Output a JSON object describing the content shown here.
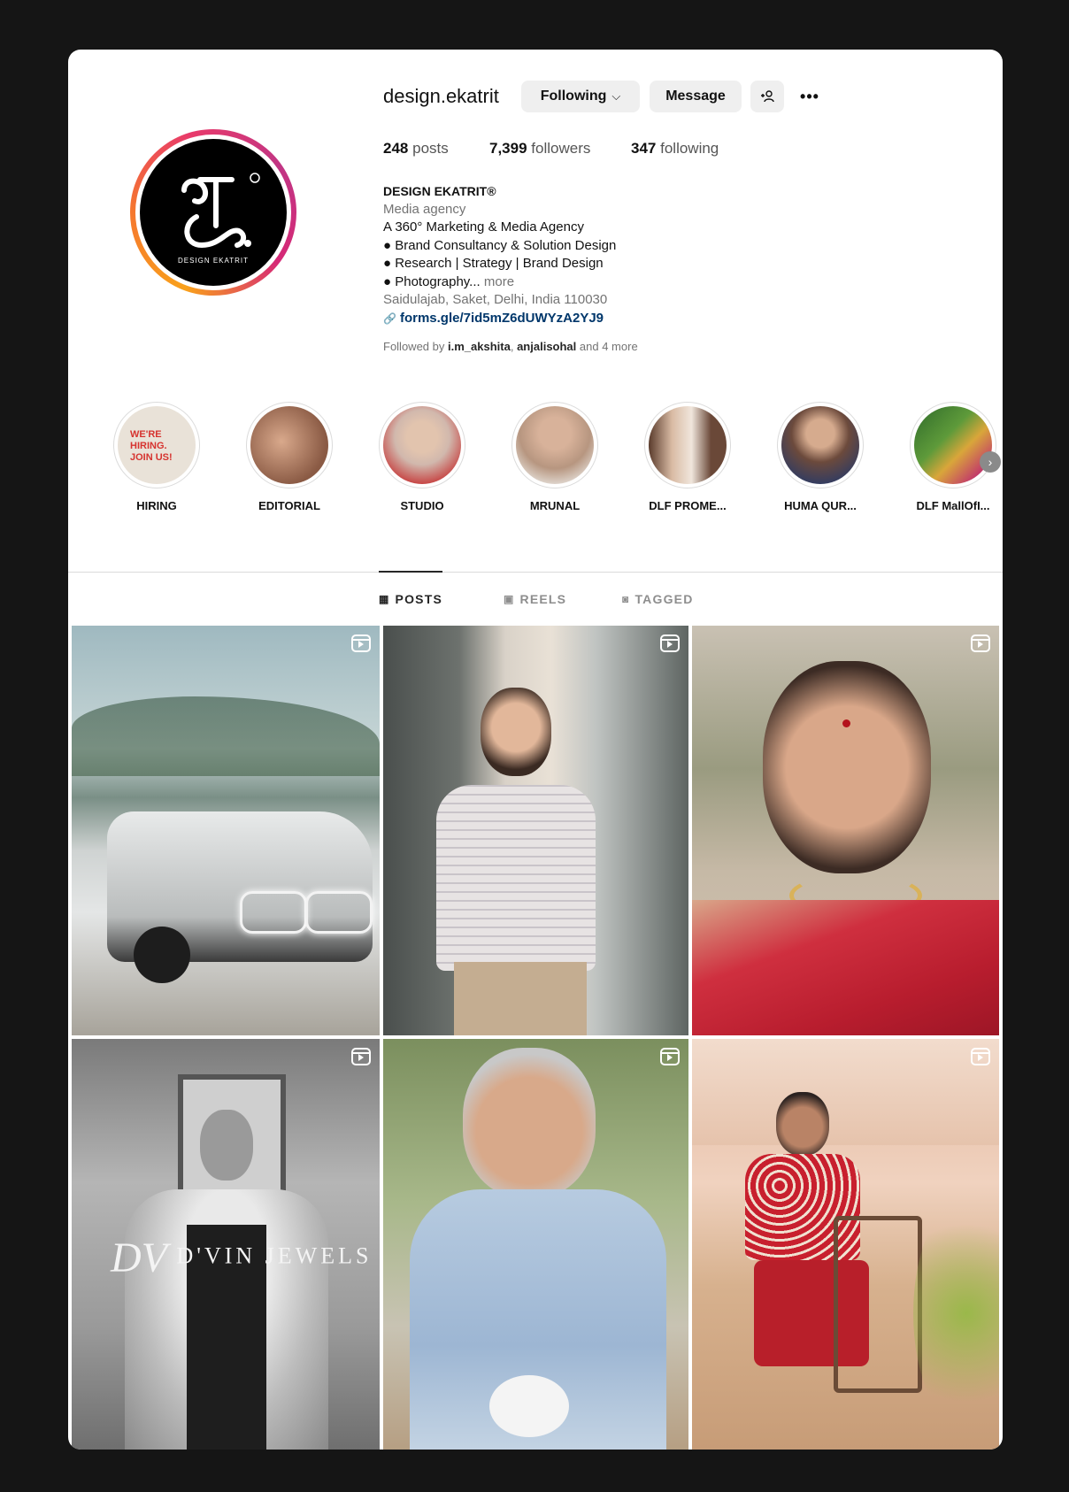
{
  "profile": {
    "username": "design.ekatrit",
    "following_label": "Following",
    "message_label": "Message",
    "add_user_icon": "add-user-icon",
    "more_icon": "more-icon",
    "avatar_caption": "DESIGN EKATRIT"
  },
  "stats": {
    "posts_count": "248",
    "posts_label": "posts",
    "followers_count": "7,399",
    "followers_label": "followers",
    "following_count": "347",
    "following_label": "following"
  },
  "bio": {
    "name": "DESIGN EKATRIT®",
    "category": "Media agency",
    "line1": "A 360° Marketing & Media Agency",
    "line2": "● Brand Consultancy & Solution Design",
    "line3": "● Research | Strategy | Brand Design",
    "line4": "● Photography...",
    "more": "more",
    "location": "Saidulajab, Saket, Delhi, India 110030",
    "link": "forms.gle/7id5mZ6dUWYzA2YJ9"
  },
  "followed_by": {
    "prefix": "Followed by",
    "user1": "i.m_akshita",
    "sep": ",",
    "user2": "anjalisohal",
    "suffix": "and 4 more"
  },
  "highlights": [
    {
      "label": "HIRING",
      "color": "#e9e2d8"
    },
    {
      "label": "EDITORIAL",
      "color": "#b58b72"
    },
    {
      "label": "STUDIO",
      "color": "#c9b7ad"
    },
    {
      "label": "MRUNAL",
      "color": "#a98a70"
    },
    {
      "label": "DLF PROME...",
      "color": "#8c6d5c"
    },
    {
      "label": "HUMA QUR...",
      "color": "#6f5548"
    },
    {
      "label": "DLF MallOfI...",
      "color": "#3f7a3a"
    }
  ],
  "highlight_hiring_text": "WE'RE HIRING. JOIN US!",
  "tabs": {
    "posts": "POSTS",
    "reels": "REELS",
    "tagged": "TAGGED"
  },
  "posts": [
    {
      "name": "post-car",
      "reel": true
    },
    {
      "name": "post-checked-shirt",
      "reel": true
    },
    {
      "name": "post-red-saree",
      "reel": true
    },
    {
      "name": "post-dvin-jewels",
      "reel": true,
      "watermark": "D'VIN JEWELS",
      "monogram": "DV"
    },
    {
      "name": "post-elderly-woman",
      "reel": true
    },
    {
      "name": "post-floral-shirt",
      "reel": true
    }
  ],
  "colors": {
    "background": "#151515",
    "link": "#00376b",
    "muted": "#737373"
  }
}
